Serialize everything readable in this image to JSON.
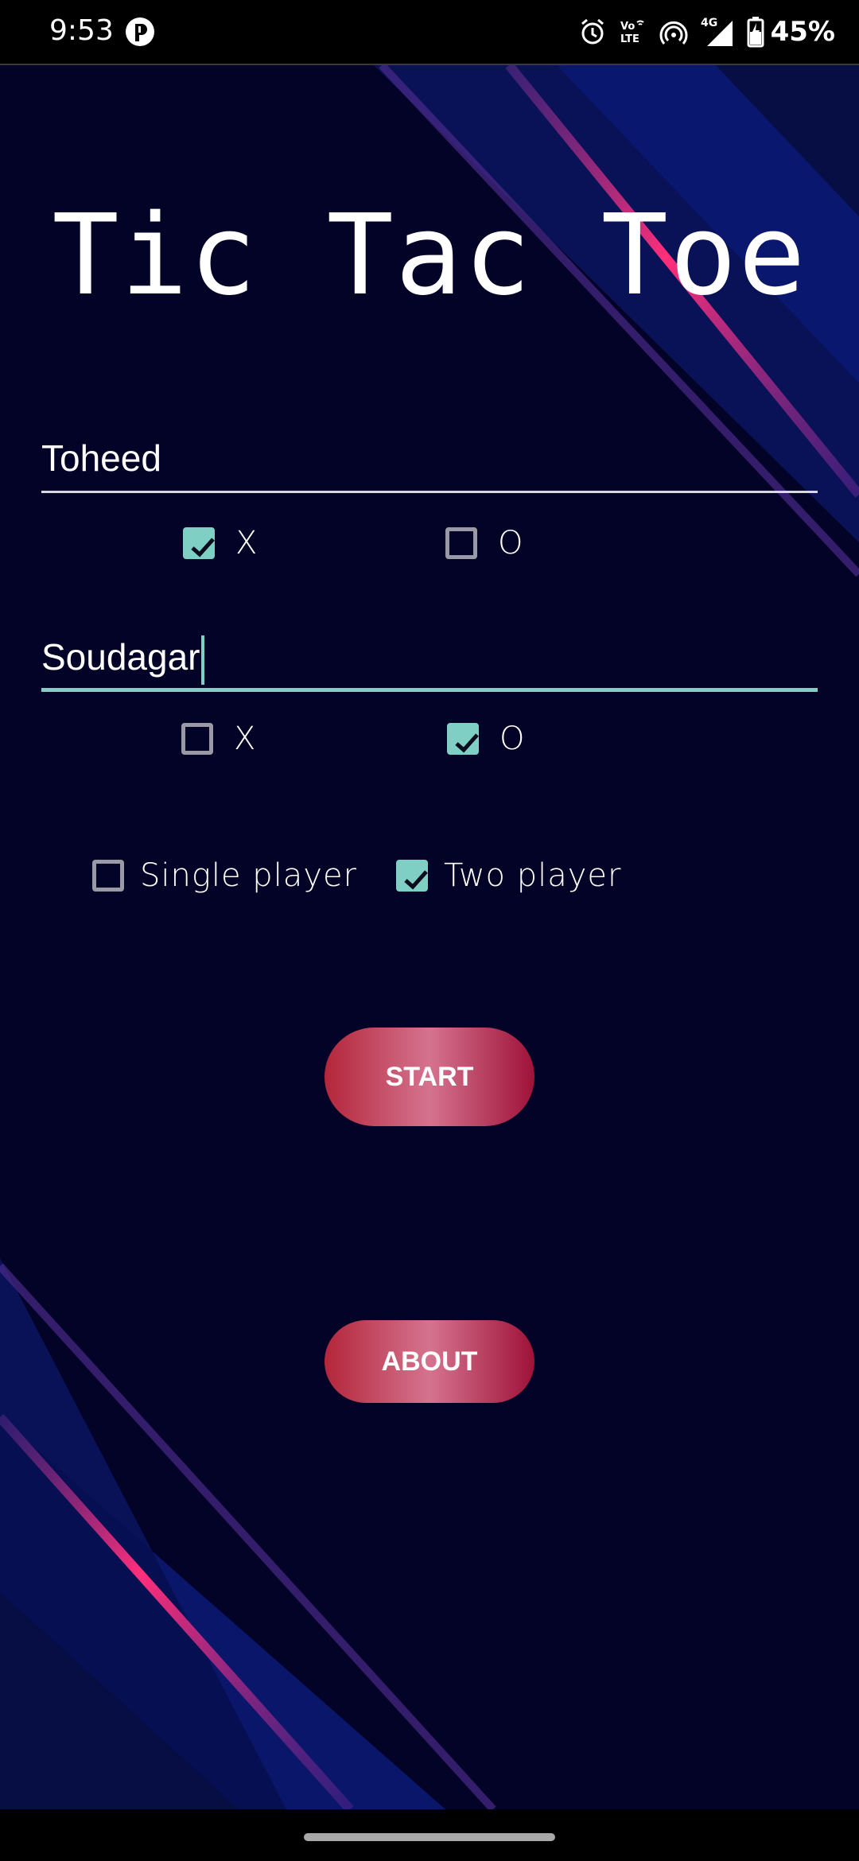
{
  "status_bar": {
    "time": "9:53",
    "battery_percent": "45%",
    "network": "4G",
    "volte": "VoLTE",
    "icons": [
      "app-notification-icon",
      "alarm-icon",
      "volte-icon",
      "hotspot-icon",
      "signal-icon",
      "battery-charging-icon"
    ]
  },
  "title": "Tic Tac Toe",
  "player1": {
    "name": "Toheed",
    "option_x": {
      "label": "X",
      "checked": true
    },
    "option_o": {
      "label": "O",
      "checked": false
    }
  },
  "player2": {
    "name": "Soudagar",
    "option_x": {
      "label": "X",
      "checked": false
    },
    "option_o": {
      "label": "O",
      "checked": true
    }
  },
  "mode": {
    "single": {
      "label": "Single player",
      "checked": false
    },
    "two": {
      "label": "Two player",
      "checked": true
    }
  },
  "buttons": {
    "start": "START",
    "about": "ABOUT"
  },
  "colors": {
    "background": "#030327",
    "accent": "#7fcfc4",
    "button_start": "#b3263a",
    "button_end": "#9e1238",
    "stripe_blue": "#0a1a6e",
    "stripe_pink": "#ff2f7a"
  }
}
